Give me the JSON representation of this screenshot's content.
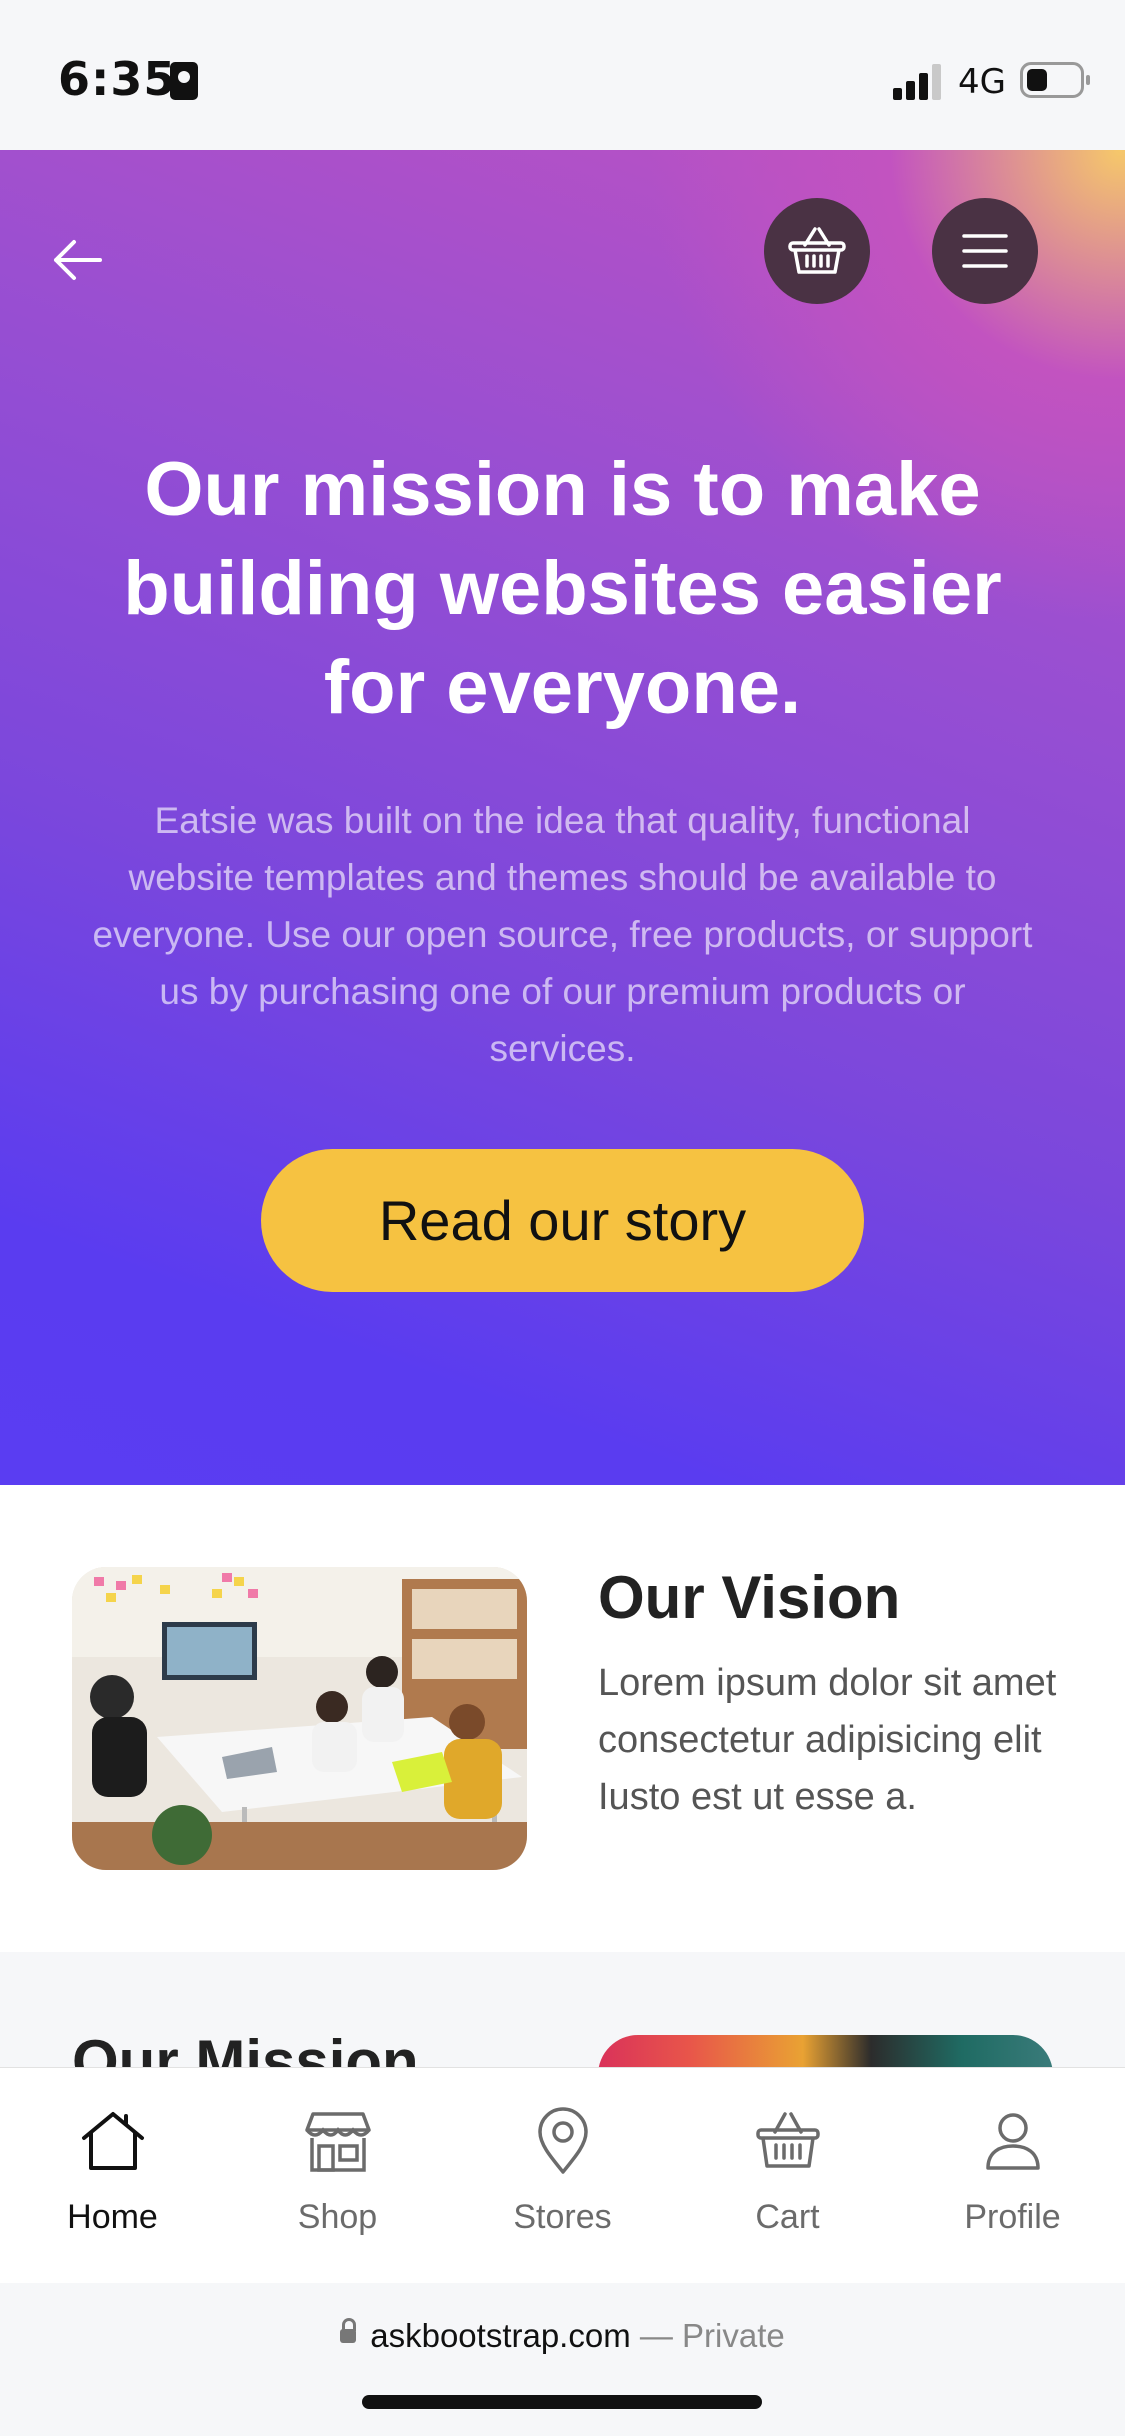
{
  "status_bar": {
    "time": "6:35",
    "network": "4G",
    "icons": [
      "contact-card-icon",
      "signal-icon",
      "battery-icon"
    ]
  },
  "header": {
    "icons": [
      "back-arrow-icon",
      "basket-icon",
      "menu-icon"
    ]
  },
  "hero": {
    "title": "Our mission is to make building websites easier for everyone.",
    "text": "Eatsie was built on the idea that quality, functional website templates and themes should be available to everyone. Use our open source, free products, or support us by purchasing one of our premium products or services.",
    "cta_label": "Read our story",
    "colors": {
      "gradient_top": "#bf52c1",
      "gradient_bottom": "#5a3df2",
      "cta": "#f6c241"
    }
  },
  "vision": {
    "title": "Our Vision",
    "text": "Lorem ipsum dolor sit amet consectetur adipisicing elit Iusto est ut esse a."
  },
  "mission": {
    "title": "Our Mission"
  },
  "bottom_nav": {
    "items": [
      {
        "label": "Home",
        "icon": "home-icon",
        "active": true
      },
      {
        "label": "Shop",
        "icon": "store-icon",
        "active": false
      },
      {
        "label": "Stores",
        "icon": "location-pin-icon",
        "active": false
      },
      {
        "label": "Cart",
        "icon": "basket-icon",
        "active": false
      },
      {
        "label": "Profile",
        "icon": "user-icon",
        "active": false
      }
    ]
  },
  "url_bar": {
    "domain": "askbootstrap.com",
    "separator": "—",
    "mode": "Private"
  }
}
